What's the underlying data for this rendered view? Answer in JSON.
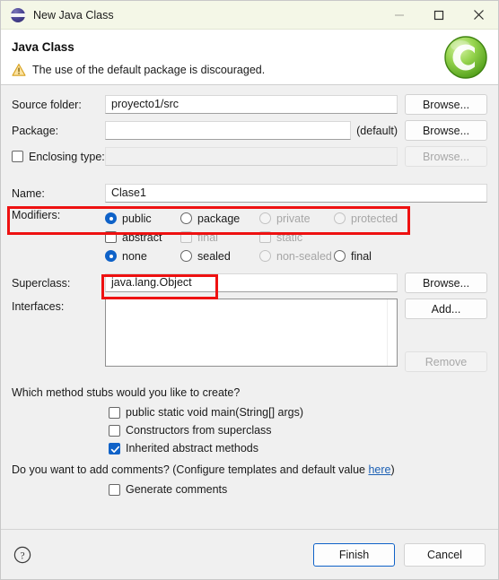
{
  "window": {
    "title": "New Java Class",
    "icon": "java-class-icon",
    "controls": {
      "minimize": "minimize-icon",
      "maximize": "maximize-icon",
      "close": "close-icon"
    }
  },
  "header": {
    "title": "Java Class",
    "message": "The use of the default package is discouraged.",
    "message_icon": "warning-icon",
    "logo": "eclipse-class-logo",
    "warning_color": "#e8a72e",
    "logo_color": "#7ac943"
  },
  "form": {
    "source_folder": {
      "label": "Source folder:",
      "value": "proyecto1/src",
      "browse": "Browse..."
    },
    "package": {
      "label": "Package:",
      "value": "",
      "suffix": "(default)",
      "browse": "Browse..."
    },
    "enclosing_type": {
      "label": "Enclosing type:",
      "value": "",
      "checked": false,
      "browse": "Browse..."
    },
    "name": {
      "label": "Name:",
      "value": "Clase1"
    },
    "modifiers": {
      "label": "Modifiers:",
      "row1": [
        {
          "label": "public",
          "checked": true,
          "enabled": true
        },
        {
          "label": "package",
          "checked": false,
          "enabled": true
        },
        {
          "label": "private",
          "checked": false,
          "enabled": false
        },
        {
          "label": "protected",
          "checked": false,
          "enabled": false
        }
      ],
      "row2": [
        {
          "label": "abstract",
          "checked": false,
          "enabled": true
        },
        {
          "label": "final",
          "checked": false,
          "enabled": false
        },
        {
          "label": "static",
          "checked": false,
          "enabled": false
        }
      ],
      "row3": [
        {
          "label": "none",
          "checked": true,
          "enabled": true
        },
        {
          "label": "sealed",
          "checked": false,
          "enabled": true
        },
        {
          "label": "non-sealed",
          "checked": false,
          "enabled": false
        },
        {
          "label": "final",
          "checked": false,
          "enabled": true
        }
      ]
    },
    "superclass": {
      "label": "Superclass:",
      "value": "java.lang.Object",
      "browse": "Browse..."
    },
    "interfaces": {
      "label": "Interfaces:",
      "items": [],
      "add": "Add...",
      "remove": "Remove"
    },
    "stubs": {
      "question": "Which method stubs would you like to create?",
      "options": [
        {
          "label": "public static void main(String[] args)",
          "checked": false
        },
        {
          "label": "Constructors from superclass",
          "checked": false
        },
        {
          "label": "Inherited abstract methods",
          "checked": true
        }
      ]
    },
    "comments": {
      "text_before": "Do you want to add comments? (Configure templates and default value ",
      "link": "here",
      "text_after": ")",
      "option": {
        "label": "Generate comments",
        "checked": false
      }
    }
  },
  "footer": {
    "help": "help-icon",
    "finish": "Finish",
    "cancel": "Cancel"
  },
  "annotations": {
    "highlight_color": "#ee1111",
    "boxes": [
      {
        "name": "package-row-highlight"
      },
      {
        "name": "name-field-highlight"
      }
    ]
  }
}
